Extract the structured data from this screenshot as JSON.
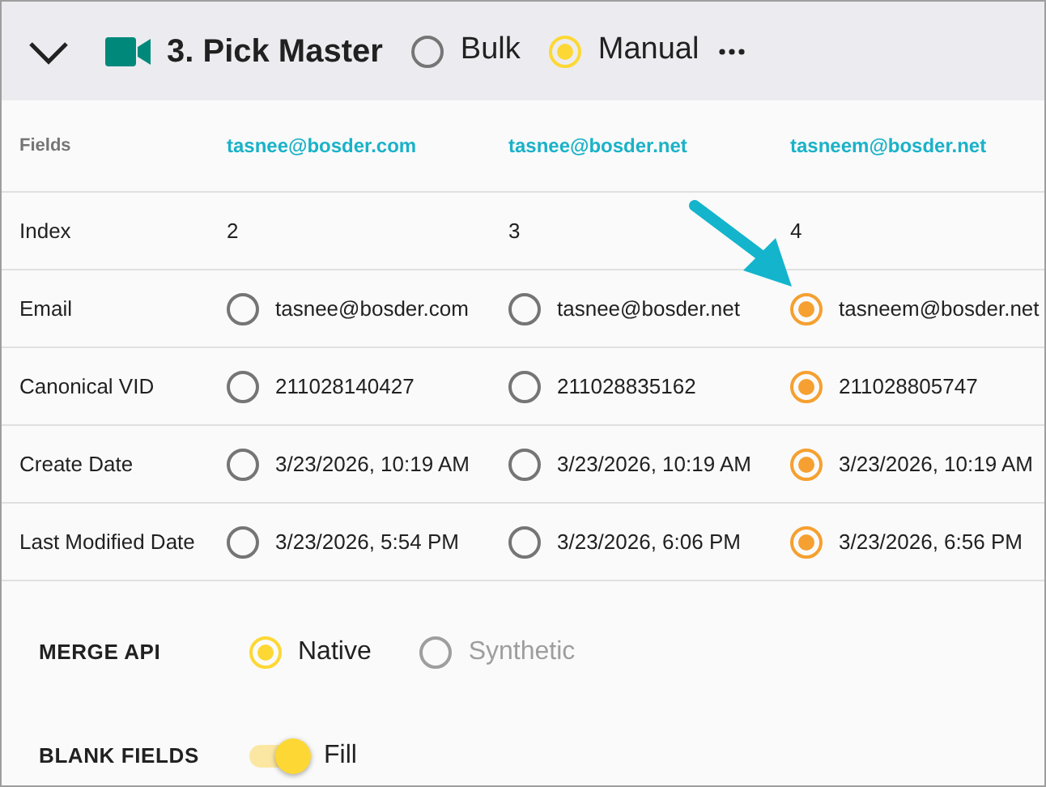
{
  "header": {
    "title": "3. Pick Master",
    "expanded": true,
    "modes": [
      {
        "label": "Bulk",
        "selected": false
      },
      {
        "label": "Manual",
        "selected": true
      }
    ]
  },
  "table": {
    "columns": [
      "Fields",
      "tasnee@bosder.com",
      "tasnee@bosder.net",
      "tasneem@bosder.net"
    ],
    "rows": [
      {
        "kind": "text",
        "cells": [
          {
            "text": "Index"
          },
          {
            "text": "2"
          },
          {
            "text": "3"
          },
          {
            "text": "4"
          }
        ]
      },
      {
        "kind": "choice",
        "cells": [
          {
            "text": "Email"
          },
          {
            "text": "tasnee@bosder.com",
            "selected": false
          },
          {
            "text": "tasnee@bosder.net",
            "selected": false
          },
          {
            "text": "tasneem@bosder.net",
            "selected": true
          }
        ]
      },
      {
        "kind": "choice",
        "cells": [
          {
            "text": "Canonical VID"
          },
          {
            "text": "211028140427",
            "selected": false
          },
          {
            "text": "211028835162",
            "selected": false
          },
          {
            "text": "211028805747",
            "selected": true
          }
        ]
      },
      {
        "kind": "choice",
        "cells": [
          {
            "text": "Create Date"
          },
          {
            "text": "3/23/2026, 10:19 AM",
            "selected": false
          },
          {
            "text": "3/23/2026, 10:19 AM",
            "selected": false
          },
          {
            "text": "3/23/2026, 10:19 AM",
            "selected": true
          }
        ]
      },
      {
        "kind": "choice",
        "cells": [
          {
            "text": "Last Modified Date"
          },
          {
            "text": "3/23/2026, 5:54 PM",
            "selected": false
          },
          {
            "text": "3/23/2026, 6:06 PM",
            "selected": false
          },
          {
            "text": "3/23/2026, 6:56 PM",
            "selected": true
          }
        ]
      }
    ]
  },
  "merge_api": {
    "label": "MERGE API",
    "options": [
      {
        "label": "Native",
        "selected": true,
        "disabled": false
      },
      {
        "label": "Synthetic",
        "selected": false,
        "disabled": true
      }
    ]
  },
  "blank_fields": {
    "label": "BLANK FIELDS",
    "on": true,
    "text": "Fill"
  }
}
